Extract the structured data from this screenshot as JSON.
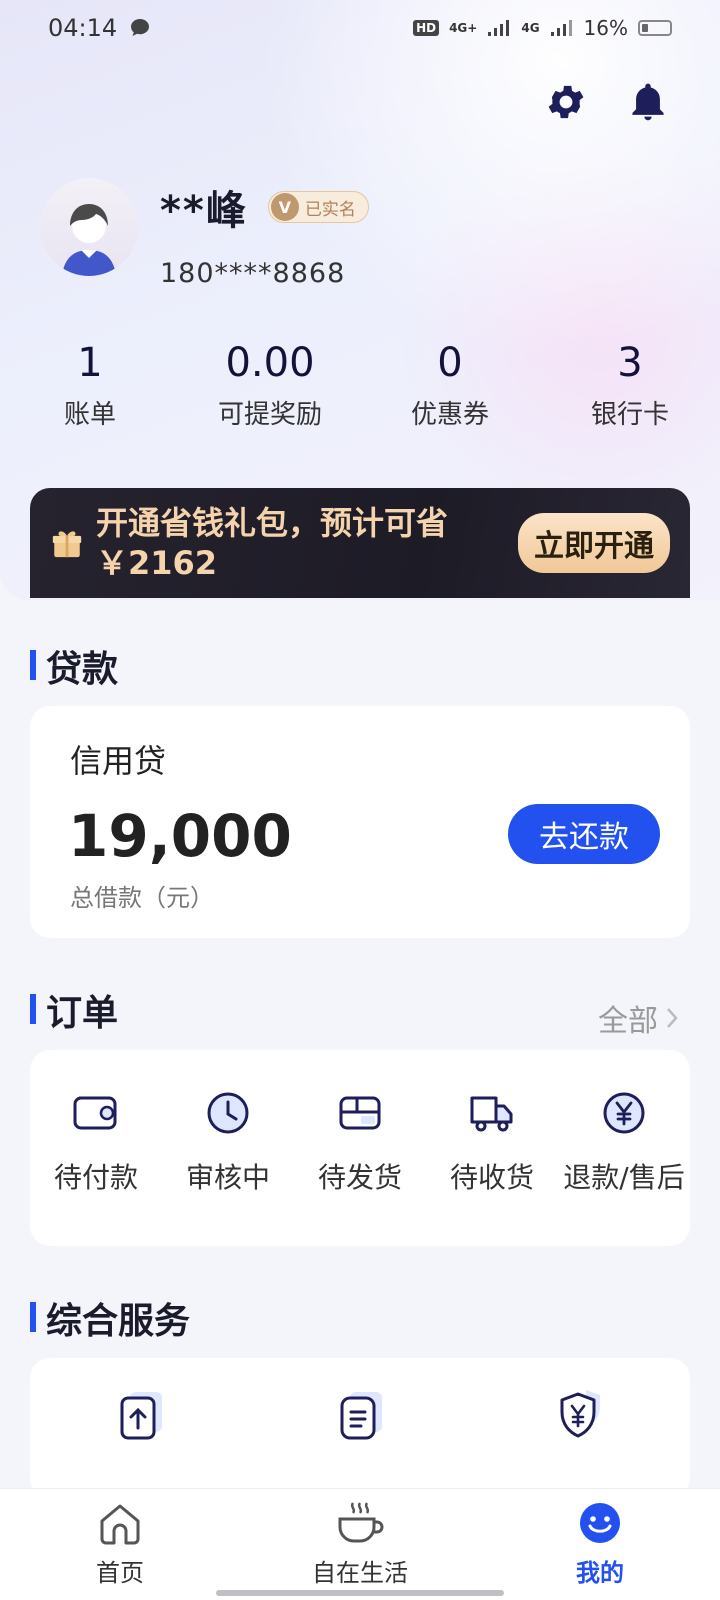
{
  "status_bar": {
    "time": "04:14",
    "battery": "16%",
    "net1": "HD",
    "net2": "4G+",
    "net3": "4G"
  },
  "profile": {
    "name": "**峰",
    "verified_badge": "V",
    "verified_label": "已实名",
    "phone": "180****8868"
  },
  "stats": [
    {
      "value": "1",
      "label": "账单"
    },
    {
      "value": "0.00",
      "label": "可提奖励"
    },
    {
      "value": "0",
      "label": "优惠券"
    },
    {
      "value": "3",
      "label": "银行卡"
    }
  ],
  "promo": {
    "text": "开通省钱礼包，预计可省￥2162",
    "button": "立即开通"
  },
  "loan": {
    "section_title": "贷款",
    "type": "信用贷",
    "amount": "19,000",
    "amount_label": "总借款（元）",
    "repay_button": "去还款"
  },
  "orders": {
    "section_title": "订单",
    "view_all": "全部",
    "items": [
      {
        "label": "待付款",
        "icon": "wallet-icon"
      },
      {
        "label": "审核中",
        "icon": "clock-icon"
      },
      {
        "label": "待发货",
        "icon": "package-icon"
      },
      {
        "label": "待收货",
        "icon": "truck-icon"
      },
      {
        "label": "退款/售后",
        "icon": "refund-icon"
      }
    ]
  },
  "services": {
    "section_title": "综合服务",
    "items": [
      {
        "icon": "upload-doc-icon"
      },
      {
        "icon": "list-doc-icon"
      },
      {
        "icon": "shield-yuan-icon"
      }
    ]
  },
  "tabbar": [
    {
      "label": "首页",
      "icon": "home-icon"
    },
    {
      "label": "自在生活",
      "icon": "coffee-icon"
    },
    {
      "label": "我的",
      "icon": "smile-icon"
    }
  ],
  "colors": {
    "accent": "#2251f0",
    "promo_bg": "#1d1b26",
    "promo_text": "#f4d3ad"
  }
}
